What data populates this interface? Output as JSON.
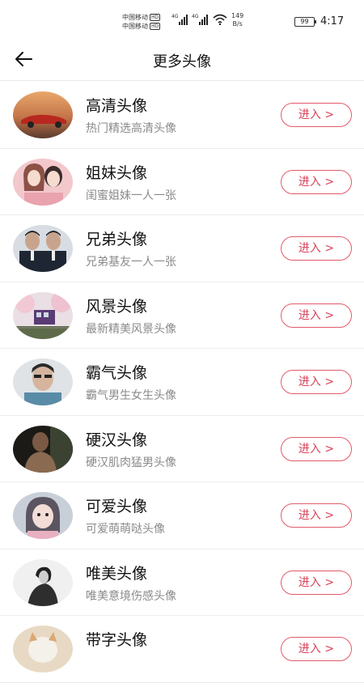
{
  "status_bar": {
    "carrier_1": "中国移动",
    "carrier_2": "中国移动",
    "hd_badge": "HD",
    "network_1": "4G",
    "network_2": "4G",
    "speed_value": "149",
    "speed_unit": "B/s",
    "battery": "99",
    "time": "4:17"
  },
  "header": {
    "back_icon": "arrow-left-icon",
    "title": "更多头像"
  },
  "items": [
    {
      "title": "高清头像",
      "subtitle": "热门精选高清头像",
      "button": "进入 >"
    },
    {
      "title": "姐妹头像",
      "subtitle": "闺蜜姐妹一人一张",
      "button": "进入 >"
    },
    {
      "title": "兄弟头像",
      "subtitle": "兄弟基友一人一张",
      "button": "进入 >"
    },
    {
      "title": "风景头像",
      "subtitle": "最新精美风景头像",
      "button": "进入 >"
    },
    {
      "title": "霸气头像",
      "subtitle": "霸气男生女生头像",
      "button": "进入 >"
    },
    {
      "title": "硬汉头像",
      "subtitle": "硬汉肌肉猛男头像",
      "button": "进入 >"
    },
    {
      "title": "可爱头像",
      "subtitle": "可爱萌萌哒头像",
      "button": "进入 >"
    },
    {
      "title": "唯美头像",
      "subtitle": "唯美意境伤感头像",
      "button": "进入 >"
    },
    {
      "title": "带字头像",
      "subtitle": "",
      "button": "进入 >"
    }
  ],
  "colors": {
    "accent": "#d9435a",
    "accent_border": "#e25a6a",
    "subtitle": "#8a8a8a"
  }
}
